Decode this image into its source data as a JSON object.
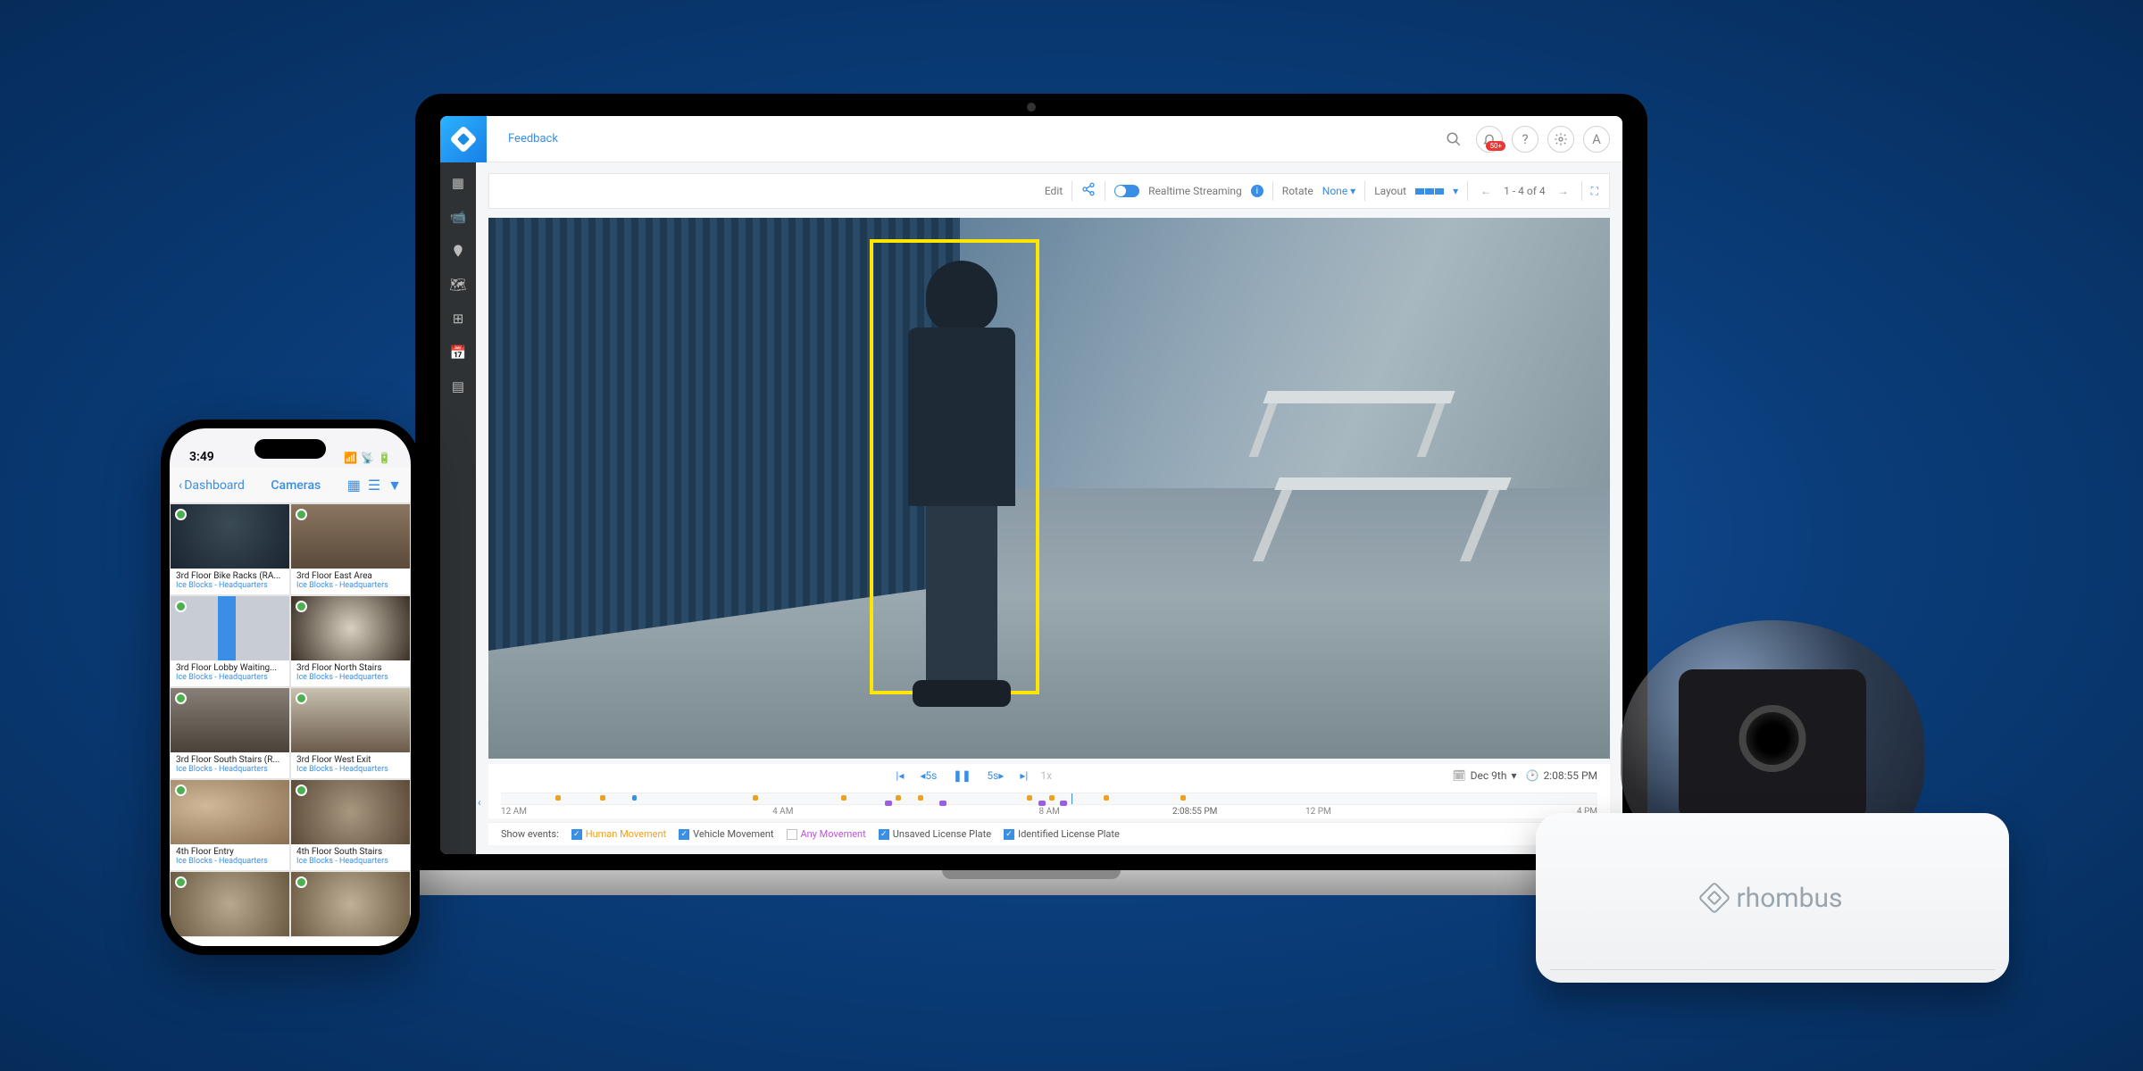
{
  "laptop": {
    "topbar": {
      "feedback_label": "Feedback",
      "notification_badge": "50+",
      "avatar_letter": "A"
    },
    "toolbar": {
      "edit_label": "Edit",
      "streaming_label": "Realtime Streaming",
      "rotate_label": "Rotate",
      "rotate_value": "None",
      "layout_label": "Layout",
      "pager_text": "1 - 4 of 4"
    },
    "playback": {
      "back_skip": "5s",
      "fwd_skip": "5s",
      "speed": "1x",
      "date": "Dec 9th",
      "time": "2:08:55 PM"
    },
    "timeline": {
      "labels": [
        "12 AM",
        "4 AM",
        "8 AM",
        "12 PM",
        "4 PM"
      ],
      "playhead_time": "2:08:55 PM"
    },
    "events": {
      "prefix": "Show events:",
      "items": [
        {
          "label": "Human Movement",
          "checked": true,
          "color": "orange"
        },
        {
          "label": "Vehicle Movement",
          "checked": true,
          "color": "default"
        },
        {
          "label": "Any Movement",
          "checked": false,
          "color": "purple"
        },
        {
          "label": "Unsaved License Plate",
          "checked": true,
          "color": "default"
        },
        {
          "label": "Identified License Plate",
          "checked": true,
          "color": "default"
        }
      ]
    }
  },
  "phone": {
    "status_time": "3:49",
    "back_label": "Dashboard",
    "title": "Cameras",
    "cameras": [
      {
        "name": "3rd Floor Bike Racks (RA...",
        "loc": "Ice Blocks - Headquarters"
      },
      {
        "name": "3rd Floor East Area",
        "loc": "Ice Blocks - Headquarters"
      },
      {
        "name": "3rd Floor Lobby Waiting...",
        "loc": "Ice Blocks - Headquarters"
      },
      {
        "name": "3rd Floor North Stairs",
        "loc": "Ice Blocks - Headquarters"
      },
      {
        "name": "3rd Floor South Stairs (R...",
        "loc": "Ice Blocks - Headquarters"
      },
      {
        "name": "3rd Floor West Exit",
        "loc": "Ice Blocks - Headquarters"
      },
      {
        "name": "4th Floor Entry",
        "loc": "Ice Blocks - Headquarters"
      },
      {
        "name": "4th Floor South Stairs",
        "loc": "Ice Blocks - Headquarters"
      }
    ]
  },
  "device": {
    "brand": "rhombus"
  }
}
